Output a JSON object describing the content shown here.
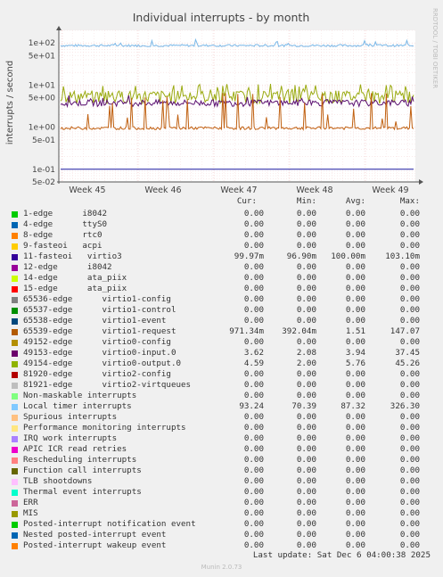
{
  "chart_data": {
    "type": "line",
    "title": "Individual interrupts - by month",
    "ylabel": "interrupts / second",
    "yscale": "log",
    "ylim": [
      0.05,
      200
    ],
    "yticks": [
      "1e+02",
      "5e+01",
      "1e+01",
      "5e+00",
      "1e+00",
      "5e-01",
      "1e-01",
      "5e-02"
    ],
    "ytick_values": [
      100,
      50,
      10,
      5,
      1,
      0.5,
      0.1,
      0.05
    ],
    "xticks": [
      "Week 45",
      "Week 46",
      "Week 47",
      "Week 48",
      "Week 49"
    ],
    "grid": true,
    "side_label": "RRDTOOL / TOBI OETIKER",
    "series": [
      {
        "name": "Local timer interrupts",
        "color": "#7ab8e8",
        "base": 87,
        "jitter": 0.06,
        "spikes": 0.05,
        "spikeMul": 1.4
      },
      {
        "name": "49154-edge virtio0-output.0",
        "color": "#9aaa10",
        "base": 5.5,
        "jitter": 0.35,
        "spikes": 0.12,
        "spikeMul": 2.0
      },
      {
        "name": "49153-edge virtio0-input.0",
        "color": "#5a0f70",
        "base": 3.8,
        "jitter": 0.18,
        "spikes": 0.04,
        "spikeMul": 1.5
      },
      {
        "name": "65539-edge virtio1-request",
        "color": "#c06010",
        "base": 0.95,
        "jitter": 0.08,
        "spikes": 0.07,
        "spikeMul": 7
      },
      {
        "name": "11-fasteoi virtio3",
        "color": "#1a1aa0",
        "base": 0.1,
        "jitter": 0.0,
        "spikes": 0,
        "spikeMul": 1
      }
    ]
  },
  "legend": {
    "headers": {
      "cur": "Cur:",
      "min": "Min:",
      "avg": "Avg:",
      "max": "Max:"
    },
    "rows": [
      {
        "label": "1-edge      i8042",
        "color": "#00cc00",
        "cur": "0.00",
        "min": "0.00",
        "avg": "0.00",
        "max": "0.00"
      },
      {
        "label": "4-edge      ttyS0",
        "color": "#0066b3",
        "cur": "0.00",
        "min": "0.00",
        "avg": "0.00",
        "max": "0.00"
      },
      {
        "label": "8-edge      rtc0",
        "color": "#ff8000",
        "cur": "0.00",
        "min": "0.00",
        "avg": "0.00",
        "max": "0.00"
      },
      {
        "label": "9-fasteoi   acpi",
        "color": "#ffcc00",
        "cur": "0.00",
        "min": "0.00",
        "avg": "0.00",
        "max": "0.00"
      },
      {
        "label": "11-fasteoi   virtio3",
        "color": "#330099",
        "cur": "99.97m",
        "min": "96.90m",
        "avg": "100.00m",
        "max": "103.10m"
      },
      {
        "label": "12-edge      i8042",
        "color": "#990099",
        "cur": "0.00",
        "min": "0.00",
        "avg": "0.00",
        "max": "0.00"
      },
      {
        "label": "14-edge      ata_piix",
        "color": "#ccff00",
        "cur": "0.00",
        "min": "0.00",
        "avg": "0.00",
        "max": "0.00"
      },
      {
        "label": "15-edge      ata_piix",
        "color": "#ff0000",
        "cur": "0.00",
        "min": "0.00",
        "avg": "0.00",
        "max": "0.00"
      },
      {
        "label": "65536-edge      virtio1-config",
        "color": "#808080",
        "cur": "0.00",
        "min": "0.00",
        "avg": "0.00",
        "max": "0.00"
      },
      {
        "label": "65537-edge      virtio1-control",
        "color": "#008f00",
        "cur": "0.00",
        "min": "0.00",
        "avg": "0.00",
        "max": "0.00"
      },
      {
        "label": "65538-edge      virtio1-event",
        "color": "#00487d",
        "cur": "0.00",
        "min": "0.00",
        "avg": "0.00",
        "max": "0.00"
      },
      {
        "label": "65539-edge      virtio1-request",
        "color": "#b35a00",
        "cur": "971.34m",
        "min": "392.04m",
        "avg": "1.51",
        "max": "147.07"
      },
      {
        "label": "49152-edge      virtio0-config",
        "color": "#b38f00",
        "cur": "0.00",
        "min": "0.00",
        "avg": "0.00",
        "max": "0.00"
      },
      {
        "label": "49153-edge      virtio0-input.0",
        "color": "#6b006b",
        "cur": "3.62",
        "min": "2.08",
        "avg": "3.94",
        "max": "37.45"
      },
      {
        "label": "49154-edge      virtio0-output.0",
        "color": "#8fb300",
        "cur": "4.59",
        "min": "2.00",
        "avg": "5.76",
        "max": "45.26"
      },
      {
        "label": "81920-edge      virtio2-config",
        "color": "#b30000",
        "cur": "0.00",
        "min": "0.00",
        "avg": "0.00",
        "max": "0.00"
      },
      {
        "label": "81921-edge      virtio2-virtqueues",
        "color": "#bebebe",
        "cur": "0.00",
        "min": "0.00",
        "avg": "0.00",
        "max": "0.00"
      },
      {
        "label": "Non-maskable interrupts",
        "color": "#80ff80",
        "cur": "0.00",
        "min": "0.00",
        "avg": "0.00",
        "max": "0.00"
      },
      {
        "label": "Local timer interrupts",
        "color": "#80c9ff",
        "cur": "93.24",
        "min": "70.39",
        "avg": "87.32",
        "max": "326.30"
      },
      {
        "label": "Spurious interrupts",
        "color": "#ffc080",
        "cur": "0.00",
        "min": "0.00",
        "avg": "0.00",
        "max": "0.00"
      },
      {
        "label": "Performance monitoring interrupts",
        "color": "#ffe680",
        "cur": "0.00",
        "min": "0.00",
        "avg": "0.00",
        "max": "0.00"
      },
      {
        "label": "IRQ work interrupts",
        "color": "#aa80ff",
        "cur": "0.00",
        "min": "0.00",
        "avg": "0.00",
        "max": "0.00"
      },
      {
        "label": "APIC ICR read retries",
        "color": "#ee00cc",
        "cur": "0.00",
        "min": "0.00",
        "avg": "0.00",
        "max": "0.00"
      },
      {
        "label": "Rescheduling interrupts",
        "color": "#ff8080",
        "cur": "0.00",
        "min": "0.00",
        "avg": "0.00",
        "max": "0.00"
      },
      {
        "label": "Function call interrupts",
        "color": "#666600",
        "cur": "0.00",
        "min": "0.00",
        "avg": "0.00",
        "max": "0.00"
      },
      {
        "label": "TLB shootdowns",
        "color": "#ffbfff",
        "cur": "0.00",
        "min": "0.00",
        "avg": "0.00",
        "max": "0.00"
      },
      {
        "label": "Thermal event interrupts",
        "color": "#00ffcc",
        "cur": "0.00",
        "min": "0.00",
        "avg": "0.00",
        "max": "0.00"
      },
      {
        "label": "ERR",
        "color": "#cc6699",
        "cur": "0.00",
        "min": "0.00",
        "avg": "0.00",
        "max": "0.00"
      },
      {
        "label": "MIS",
        "color": "#999900",
        "cur": "0.00",
        "min": "0.00",
        "avg": "0.00",
        "max": "0.00"
      },
      {
        "label": "Posted-interrupt notification event",
        "color": "#00cc00",
        "cur": "0.00",
        "min": "0.00",
        "avg": "0.00",
        "max": "0.00"
      },
      {
        "label": "Nested posted-interrupt event",
        "color": "#0066b3",
        "cur": "0.00",
        "min": "0.00",
        "avg": "0.00",
        "max": "0.00"
      },
      {
        "label": "Posted-interrupt wakeup event",
        "color": "#ff8000",
        "cur": "0.00",
        "min": "0.00",
        "avg": "0.00",
        "max": "0.00"
      }
    ]
  },
  "footer": {
    "last_update": "Last update: Sat Dec  6 04:00:38 2025",
    "munin": "Munin 2.0.73"
  }
}
